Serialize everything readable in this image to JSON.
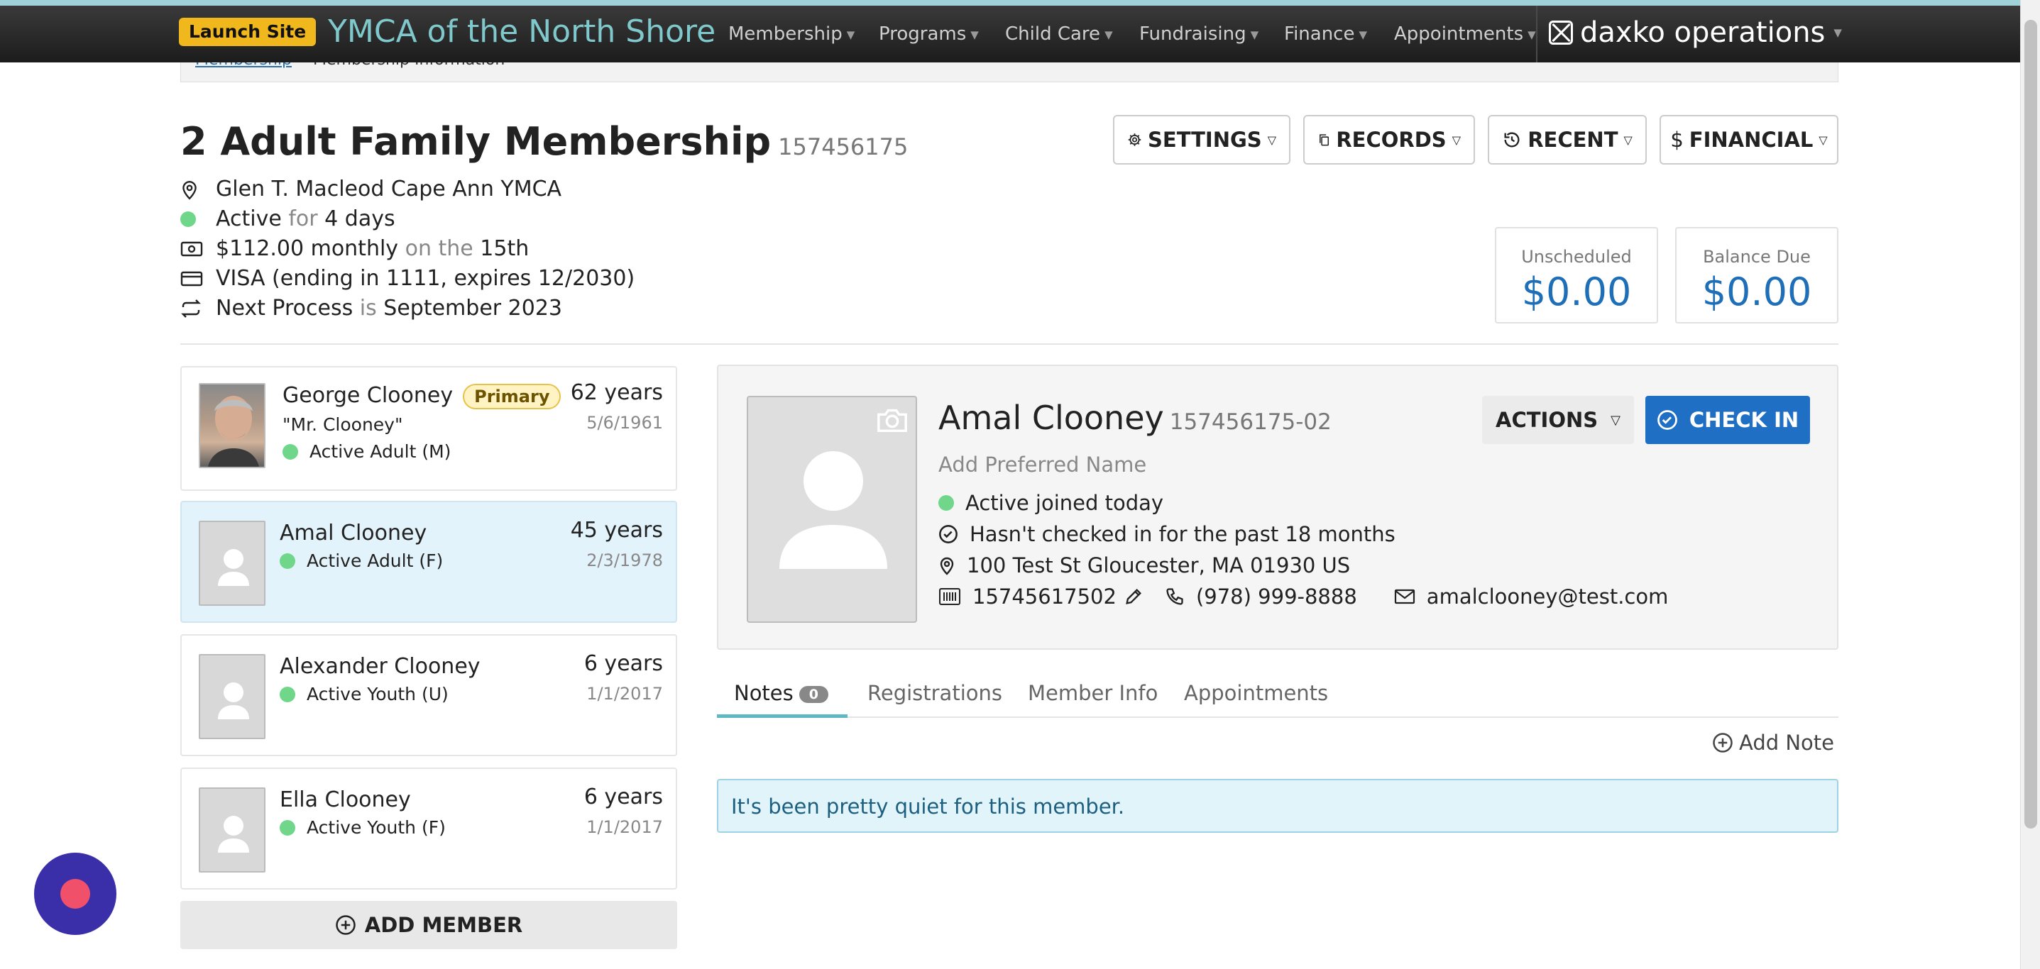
{
  "nav": {
    "launch_label": "Launch Site",
    "site_name": "YMCA of the North Shore",
    "items": [
      "Membership",
      "Programs",
      "Child Care",
      "Fundraising",
      "Finance",
      "Appointments"
    ],
    "brand": "daxko operations"
  },
  "breadcrumb": {
    "link": "Membership",
    "current": "Membership Information"
  },
  "membership": {
    "title": "2 Adult Family Membership",
    "number": "157456175",
    "branch": "Glen T. Macleod Cape Ann YMCA",
    "status_word": "Active",
    "status_for": "for",
    "status_duration": "4 days",
    "fee": "$112.00 monthly",
    "fee_on": "on the",
    "fee_day": "15th",
    "card": "VISA (ending in 1111, expires 12/2030)",
    "next_label": "Next Process",
    "next_is": "is",
    "next_date": "September 2023"
  },
  "header_buttons": {
    "settings": "SETTINGS",
    "records": "RECORDS",
    "recent": "RECENT",
    "financial": "FINANCIAL"
  },
  "balances": {
    "unscheduled_label": "Unscheduled",
    "unscheduled": "$0.00",
    "due_label": "Balance Due",
    "due": "$0.00"
  },
  "members": [
    {
      "name": "George Clooney",
      "badge": "Primary",
      "nickname": "\"Mr. Clooney\"",
      "status": "Active Adult (M)",
      "age": "62 years",
      "dob": "5/6/1961"
    },
    {
      "name": "Amal Clooney",
      "status": "Active Adult (F)",
      "age": "45 years",
      "dob": "2/3/1978"
    },
    {
      "name": "Alexander Clooney",
      "status": "Active Youth (U)",
      "age": "6 years",
      "dob": "1/1/2017"
    },
    {
      "name": "Ella Clooney",
      "status": "Active Youth (F)",
      "age": "6 years",
      "dob": "1/1/2017"
    }
  ],
  "add_member_label": "ADD MEMBER",
  "detail": {
    "name": "Amal Clooney",
    "number": "157456175-02",
    "add_preferred": "Add Preferred Name",
    "status": "Active joined today",
    "checkin_status": "Hasn't checked in for the past 18 months",
    "address": "100 Test St Gloucester, MA 01930 US",
    "barcode": "15745617502",
    "phone": "(978) 999-8888",
    "email": "amalclooney@test.com",
    "actions_label": "ACTIONS",
    "checkin_label": "CHECK IN"
  },
  "tabs": {
    "notes": "Notes",
    "notes_count": "0",
    "registrations": "Registrations",
    "member_info": "Member Info",
    "appointments": "Appointments"
  },
  "add_note_label": "Add Note",
  "empty_message": "It's been pretty quiet for this member.",
  "colors": {
    "accent": "#1f6fc4",
    "active_dot": "#6fd68a",
    "brand_teal": "#7fc9cc",
    "launch": "#f0b81c"
  }
}
